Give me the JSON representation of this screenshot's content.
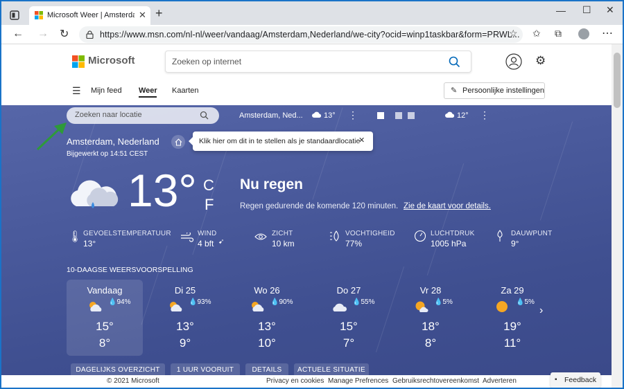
{
  "browser": {
    "tab_title": "Microsoft Weer | Amsterdam, Ne",
    "new_tab_symbol": "+",
    "url": "https://www.msn.com/nl-nl/weer/vandaag/Amsterdam,Nederland/we-city?ocid=winp1taskbar&form=PRWL..."
  },
  "header": {
    "brand": "Microsoft",
    "search_placeholder": "Zoeken op internet",
    "nav": [
      "Mijn feed",
      "Weer",
      "Kaarten"
    ],
    "personal_settings": "Persoonlijke instellingen"
  },
  "weather": {
    "location_search_placeholder": "Zoeken naar locatie",
    "favorites": [
      {
        "name": "Amsterdam, Ned...",
        "temp": "13°"
      },
      {
        "name": "",
        "temp": "12°"
      }
    ],
    "location": "Amsterdam, Nederland",
    "tooltip": "Klik hier om dit in te stellen als je standaardlocatie",
    "updated": "Bijgewerkt op 14:51 CEST",
    "current_temp": "13°",
    "unit_c": "C",
    "unit_f": "F",
    "condition": "Nu regen",
    "summary": "Regen gedurende de komende 120 minuten.",
    "map_link": "Zie de kaart voor details.",
    "metrics": [
      {
        "label": "GEVOELSTEMPERATUUR",
        "value": "13°"
      },
      {
        "label": "WIND",
        "value": "4 bft"
      },
      {
        "label": "ZICHT",
        "value": "10 km"
      },
      {
        "label": "VOCHTIGHEID",
        "value": "77%"
      },
      {
        "label": "LUCHTDRUK",
        "value": "1005 hPa"
      },
      {
        "label": "DAUWPUNT",
        "value": "9°"
      }
    ],
    "forecast_title": "10-DAAGSE WEERSVOORSPELLING",
    "forecast": [
      {
        "day": "Vandaag",
        "precip": "94%",
        "high": "15°",
        "low": "8°"
      },
      {
        "day": "Di 25",
        "precip": "93%",
        "high": "13°",
        "low": "9°"
      },
      {
        "day": "Wo 26",
        "precip": "90%",
        "high": "13°",
        "low": "10°"
      },
      {
        "day": "Do 27",
        "precip": "55%",
        "high": "15°",
        "low": "7°"
      },
      {
        "day": "Vr 28",
        "precip": "5%",
        "high": "18°",
        "low": "8°"
      },
      {
        "day": "Za 29",
        "precip": "5%",
        "high": "19°",
        "low": "11°"
      }
    ],
    "subtabs": [
      "DAGELIJKS OVERZICHT",
      "1 UUR VOORUIT",
      "DETAILS",
      "ACTUELE SITUATIE"
    ]
  },
  "footer": {
    "copyright": "© 2021 Microsoft",
    "links": [
      "Privacy en cookies",
      "Manage Prefrences",
      "Gebruiksrechtovereenkomst",
      "Adverteren"
    ],
    "feedback": "Feedback"
  },
  "colors": {
    "accent": "#0067b8",
    "weather_bg": "#4a5a9c",
    "arrow": "#2e9a3a"
  }
}
